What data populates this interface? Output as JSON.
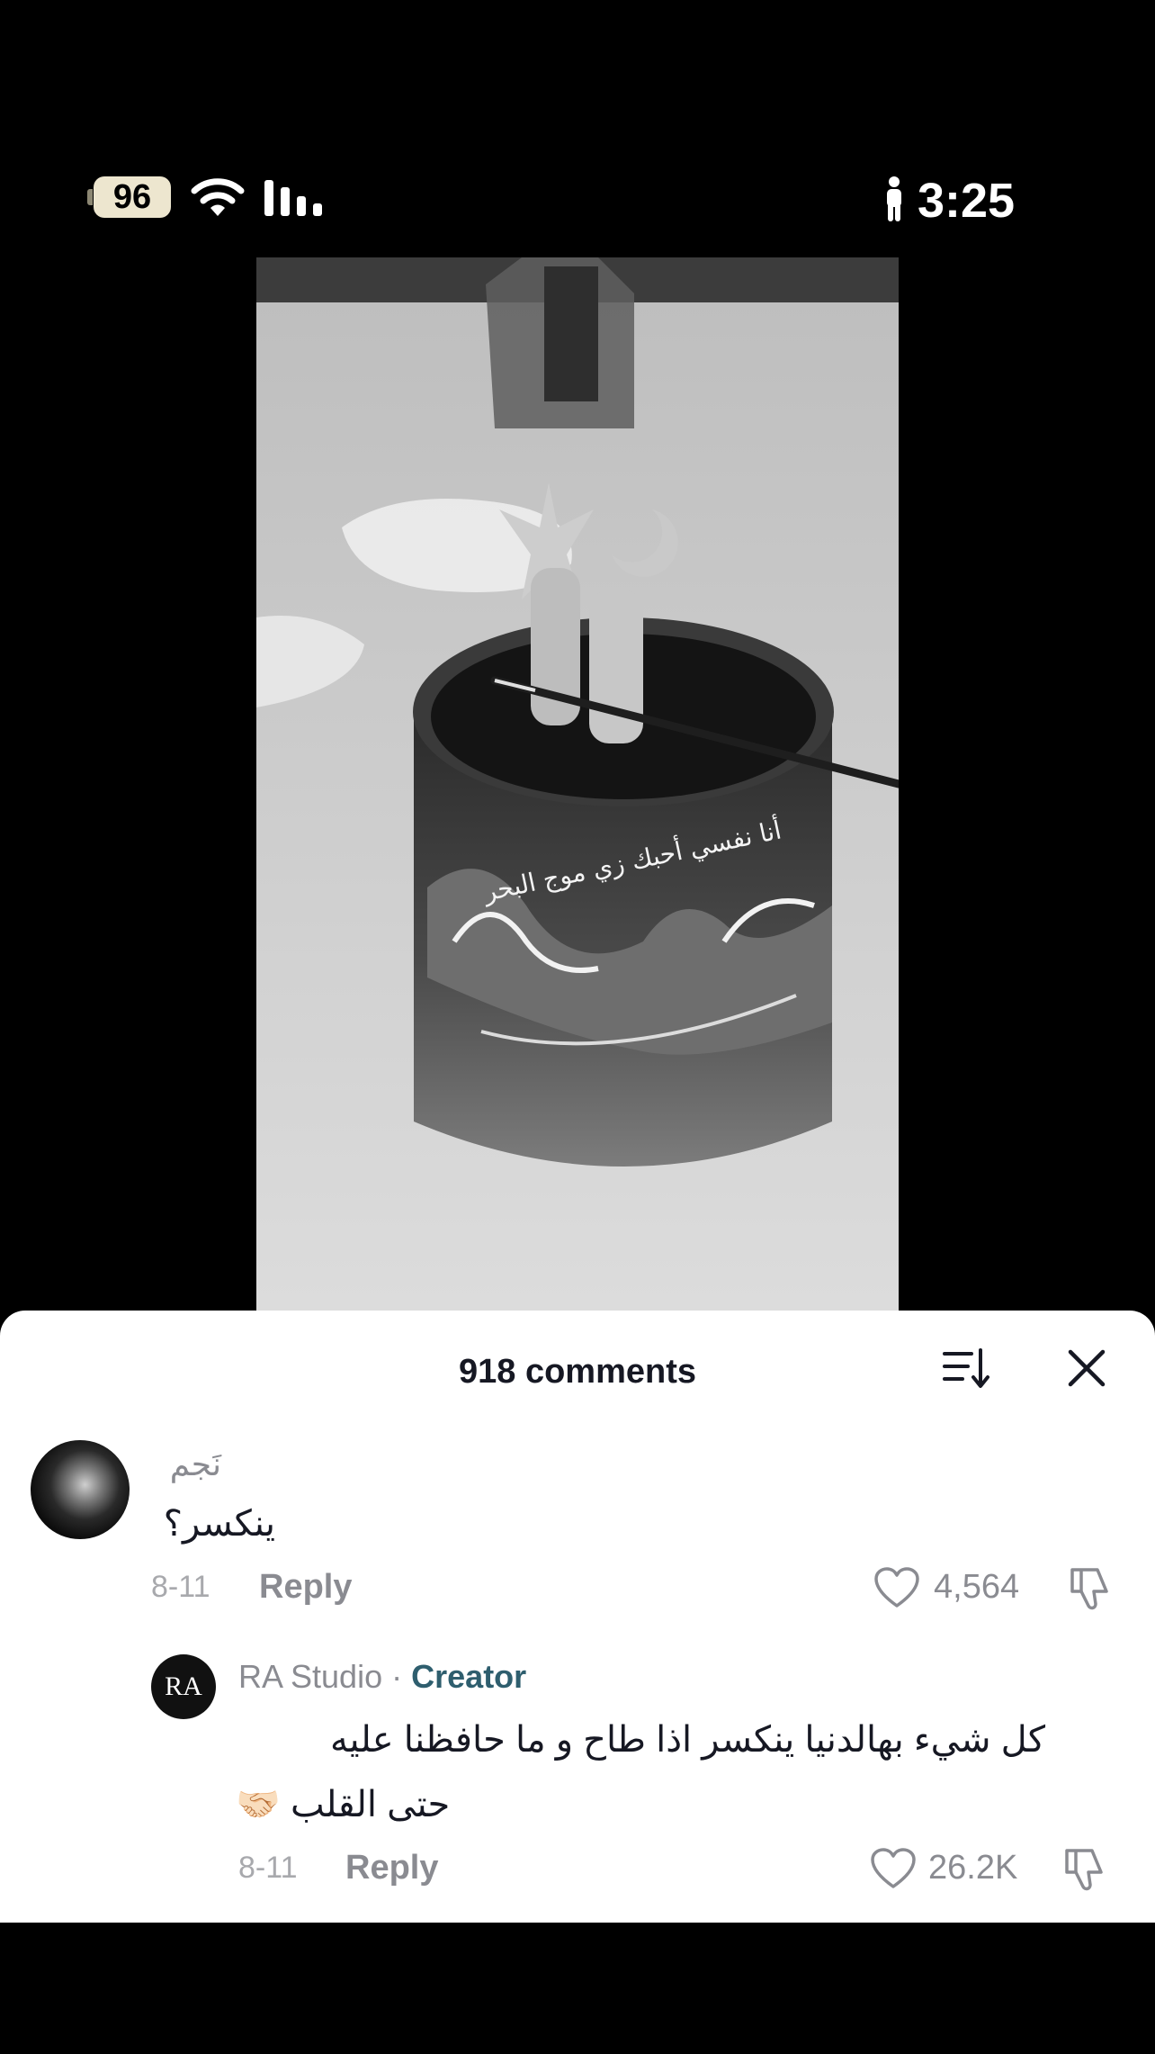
{
  "status_bar": {
    "battery": "96",
    "time": "3:25",
    "icons": [
      "battery-icon",
      "wifi-icon",
      "signal-icon",
      "person-icon"
    ]
  },
  "sheet": {
    "title": "918 comments",
    "icons": [
      "sort-icon",
      "close-icon"
    ]
  },
  "comments": [
    {
      "username": "نَجم",
      "text": "ينكسر؟",
      "date": "8-11",
      "reply_label": "Reply",
      "likes": "4,564"
    },
    {
      "username": "RA Studio",
      "badge": "Creator",
      "separator": "·",
      "avatar_text": "RA",
      "text_line1": "كل شيء بهالدنيا ينكسر اذا طاح و ما حافظنا عليه",
      "text_line2": "حتى القلب",
      "text_emoji": "🤝🏻",
      "date": "8-11",
      "reply_label": "Reply",
      "likes": "26.2K"
    }
  ],
  "video": {
    "cup_inscription": "أنا نفسي أحبك زي موج البحر"
  },
  "colors": {
    "background": "#000000",
    "sheet": "#ffffff",
    "creator": "#2e5e6e",
    "muted": "#8a8b91"
  }
}
